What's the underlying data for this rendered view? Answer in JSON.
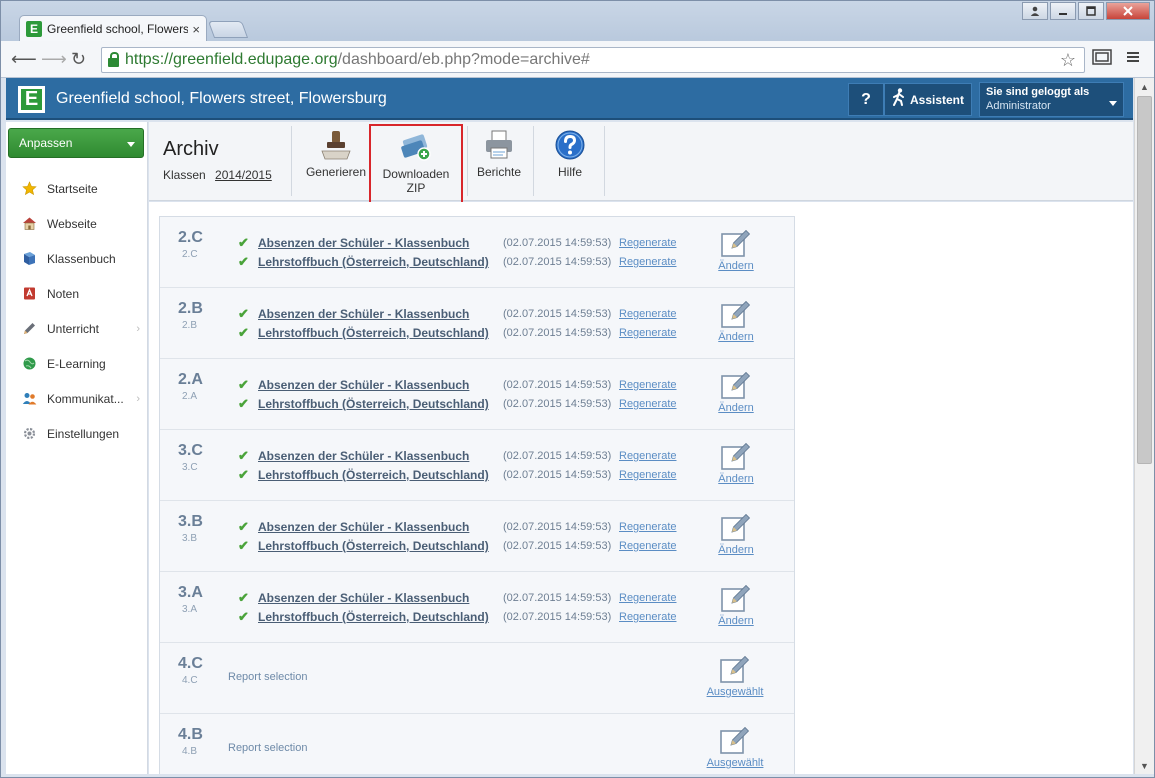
{
  "browser": {
    "tab_title": "Greenfield school, Flowers",
    "tab_close": "×",
    "favicon": "E",
    "url_host": "https://greenfield.edupage.org",
    "url_rest": "/dashboard/eb.php?mode=archive#"
  },
  "header": {
    "school_name": "Greenfield school, Flowers street, Flowersburg",
    "logo": "E",
    "help_label": "?",
    "assistant_label": "Assistent",
    "user_line1": "Sie sind geloggt als",
    "user_line2": "Administrator"
  },
  "sidebar": {
    "customize_label": "Anpassen",
    "items": [
      {
        "label": "Startseite",
        "icon": "star-icon",
        "color": "#f2b600"
      },
      {
        "label": "Webseite",
        "icon": "house-icon",
        "color": "#b9423b"
      },
      {
        "label": "Klassenbuch",
        "icon": "book-icon",
        "color": "#2f5ea0"
      },
      {
        "label": "Noten",
        "icon": "grades-icon",
        "color": "#c23b30"
      },
      {
        "label": "Unterricht",
        "icon": "pen-icon",
        "color": "#6a6f78",
        "arrow": "›"
      },
      {
        "label": "E-Learning",
        "icon": "globe-icon",
        "color": "#2f9a4a"
      },
      {
        "label": "Kommunikat...",
        "icon": "people-icon",
        "color": "#2f7fb9",
        "arrow": "›"
      },
      {
        "label": "Einstellungen",
        "icon": "gear-icon",
        "color": "#8a8f98"
      }
    ]
  },
  "archive": {
    "title": "Archiv",
    "classes_label": "Klassen",
    "school_year": "2014/2015",
    "tools": {
      "generate": "Generieren",
      "download_line1": "Downloaden",
      "download_line2": "ZIP",
      "reports": "Berichte",
      "help": "Hilfe"
    }
  },
  "rows": [
    {
      "cls": "2.C",
      "sub": "2.C",
      "r1": "Absenzen der Schüler - Klassenbuch",
      "r2": "Lehrstoffbuch (Österreich, Deutschland)",
      "d1": "(02.07.2015 14:59:53)",
      "d2": "(02.07.2015 14:59:53)",
      "regen": "Regenerate",
      "edit": "Ändern"
    },
    {
      "cls": "2.B",
      "sub": "2.B",
      "r1": "Absenzen der Schüler - Klassenbuch",
      "r2": "Lehrstoffbuch (Österreich, Deutschland)",
      "d1": "(02.07.2015 14:59:53)",
      "d2": "(02.07.2015 14:59:53)",
      "regen": "Regenerate",
      "edit": "Ändern"
    },
    {
      "cls": "2.A",
      "sub": "2.A",
      "r1": "Absenzen der Schüler - Klassenbuch",
      "r2": "Lehrstoffbuch (Österreich, Deutschland)",
      "d1": "(02.07.2015 14:59:53)",
      "d2": "(02.07.2015 14:59:53)",
      "regen": "Regenerate",
      "edit": "Ändern"
    },
    {
      "cls": "3.C",
      "sub": "3.C",
      "r1": "Absenzen der Schüler - Klassenbuch",
      "r2": "Lehrstoffbuch (Österreich, Deutschland)",
      "d1": "(02.07.2015 14:59:53)",
      "d2": "(02.07.2015 14:59:53)",
      "regen": "Regenerate",
      "edit": "Ändern"
    },
    {
      "cls": "3.B",
      "sub": "3.B",
      "r1": "Absenzen der Schüler - Klassenbuch",
      "r2": "Lehrstoffbuch (Österreich, Deutschland)",
      "d1": "(02.07.2015 14:59:53)",
      "d2": "(02.07.2015 14:59:53)",
      "regen": "Regenerate",
      "edit": "Ändern"
    },
    {
      "cls": "3.A",
      "sub": "3.A",
      "r1": "Absenzen der Schüler - Klassenbuch",
      "r2": "Lehrstoffbuch (Österreich, Deutschland)",
      "d1": "(02.07.2015 14:59:53)",
      "d2": "(02.07.2015 14:59:53)",
      "regen": "Regenerate",
      "edit": "Ändern"
    },
    {
      "cls": "4.C",
      "sub": "4.C",
      "selection": "Report selection",
      "edit": "Ausgewählt"
    },
    {
      "cls": "4.B",
      "sub": "4.B",
      "selection": "Report selection",
      "edit": "Ausgewählt"
    }
  ]
}
